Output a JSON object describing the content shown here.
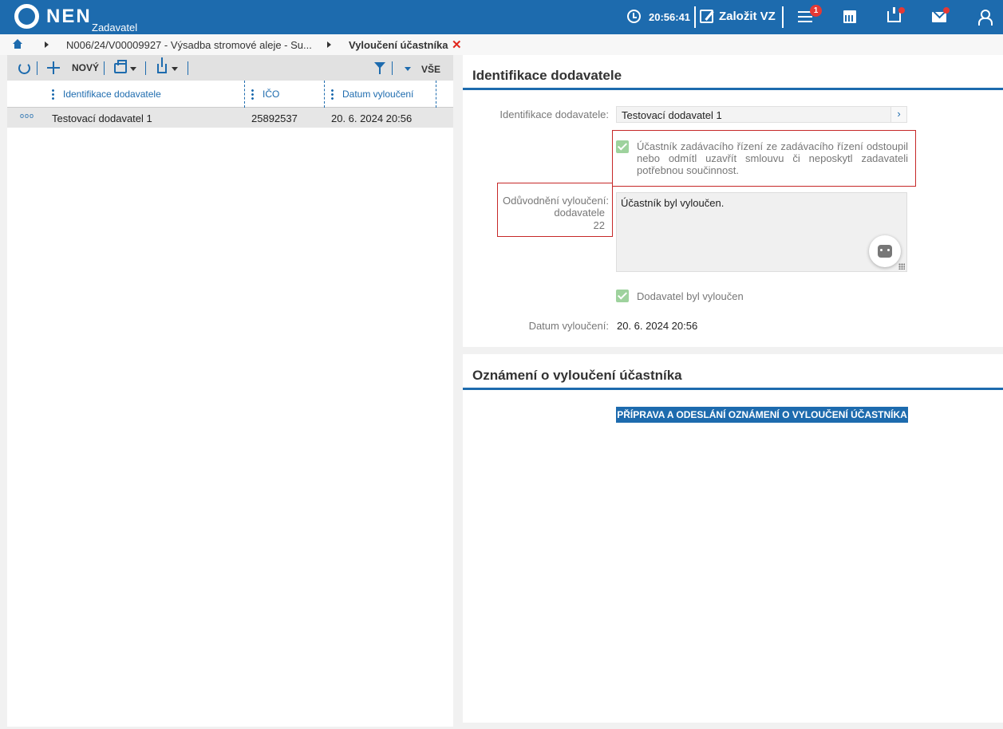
{
  "header": {
    "brand": "NEN",
    "brand_sub": "Zadavatel",
    "time": "20:56:41",
    "create_label": "Založit VZ",
    "notification_count": "1"
  },
  "breadcrumb": {
    "items": [
      "N006/24/V00009927 - Výsadba stromové aleje - Su...",
      "Vyloučení účastníka"
    ]
  },
  "toolbar": {
    "new_label": "NOVÝ",
    "all_label": "VŠE"
  },
  "table": {
    "columns": [
      "Identifikace dodavatele",
      "IČO",
      "Datum vyloučení"
    ],
    "rows": [
      {
        "name": "Testovací dodavatel 1",
        "ico": "25892537",
        "date": "20. 6. 2024 20:56"
      }
    ]
  },
  "detail": {
    "title": "Identifikace dodavatele",
    "supplier_label": "Identifikace dodavatele:",
    "supplier_value": "Testovací dodavatel 1",
    "participant_withdrew_text": "Účastník zadávacího řízení ze zadávacího řízení odstoupil nebo odmítl uzavřít smlouvu či neposkytl zadavateli potřebnou součinnost.",
    "reason_label_1": "Odůvodnění vyloučení:",
    "reason_label_2": "dodavatele",
    "reason_label_3": "22",
    "reason_value": "Účastník byl vyloučen.",
    "excluded_label": "Dodavatel byl vyloučen",
    "date_label": "Datum vyloučení:",
    "date_value": "20. 6. 2024 20:56"
  },
  "notice": {
    "title": "Oznámení o vyloučení účastníka",
    "button_label": "PŘÍPRAVA A ODESLÁNÍ OZNÁMENÍ O VYLOUČENÍ ÚČASTNÍKA"
  },
  "colors": {
    "primary": "#1d6bae",
    "alert": "#e53935",
    "check": "#9ed29d",
    "highlight_border": "#c62828"
  }
}
